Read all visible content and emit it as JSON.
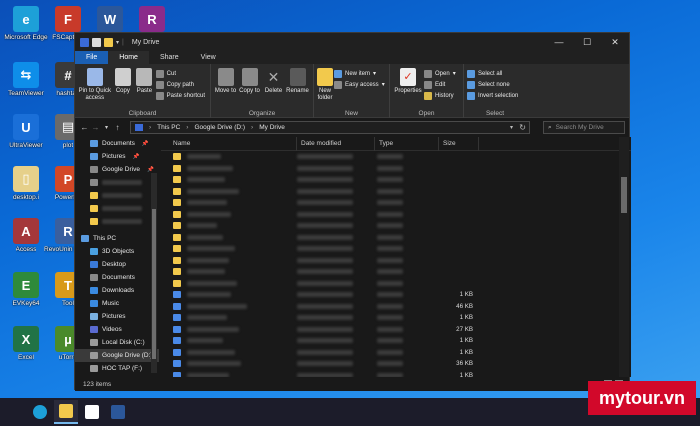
{
  "desktop": {
    "icons": [
      {
        "label": "Microsoft Edge",
        "glyph": "e",
        "color": "#1da0d8"
      },
      {
        "label": "FSCapture",
        "glyph": "F",
        "color": "#c83a2a"
      },
      {
        "label": "",
        "glyph": "W",
        "color": "#2b579a"
      },
      {
        "label": "",
        "glyph": "R",
        "color": "#8a2b8a"
      },
      {
        "label": "TeamViewer",
        "glyph": "⇆",
        "color": "#0e8ee9"
      },
      {
        "label": "hashtab",
        "glyph": "#",
        "color": "#3a3a3a"
      },
      {
        "label": "UltraViewer",
        "glyph": "U",
        "color": "#1a6fd8"
      },
      {
        "label": "plot",
        "glyph": "▤",
        "color": "#6a6a6a"
      },
      {
        "label": "desktop.i",
        "glyph": "▯",
        "color": "#e6d08a"
      },
      {
        "label": "PowerPo",
        "glyph": "P",
        "color": "#d24726"
      },
      {
        "label": "Access",
        "glyph": "A",
        "color": "#a4373a"
      },
      {
        "label": "RevoUnin Portabl",
        "glyph": "R",
        "color": "#3a5f9e"
      },
      {
        "label": "EVKey64",
        "glyph": "E",
        "color": "#2e8a3a"
      },
      {
        "label": "Tool",
        "glyph": "T",
        "color": "#d89a1a"
      },
      {
        "label": "Excel",
        "glyph": "X",
        "color": "#217346"
      },
      {
        "label": "uTorre",
        "glyph": "µ",
        "color": "#4a8a2a"
      }
    ]
  },
  "window": {
    "title": "My Drive",
    "controls": {
      "minimize": "—",
      "maximize": "☐",
      "close": "✕"
    },
    "tabs": [
      "File",
      "Home",
      "Share",
      "View"
    ],
    "ribbon": {
      "clipboard": {
        "name": "Clipboard",
        "pin": "Pin to Quick access",
        "copy": "Copy",
        "paste": "Paste",
        "cut": "Cut",
        "copy_path": "Copy path",
        "paste_shortcut": "Paste shortcut"
      },
      "organize": {
        "name": "Organize",
        "move_to": "Move to",
        "copy_to": "Copy to",
        "delete": "Delete",
        "rename": "Rename"
      },
      "new": {
        "name": "New",
        "new_folder": "New folder",
        "new_item": "New item",
        "easy_access": "Easy access"
      },
      "open": {
        "name": "Open",
        "properties": "Properties",
        "open": "Open",
        "edit": "Edit",
        "history": "History"
      },
      "select": {
        "name": "Select",
        "select_all": "Select all",
        "select_none": "Select none",
        "invert": "Invert selection"
      }
    },
    "address": {
      "crumbs": [
        "This PC",
        "Google Drive (D:)",
        "My Drive"
      ]
    },
    "search_placeholder": "Search My Drive",
    "navpane": {
      "quick": [
        {
          "label": "Documents",
          "pin": true,
          "color": "#5a9be0"
        },
        {
          "label": "Pictures",
          "pin": true,
          "color": "#5a9be0"
        },
        {
          "label": "Google Drive",
          "pin": true,
          "color": "#888888"
        }
      ],
      "this_pc": "This PC",
      "pc_items": [
        {
          "label": "3D Objects",
          "color": "#4aa0e0"
        },
        {
          "label": "Desktop",
          "color": "#3a7ad8"
        },
        {
          "label": "Documents",
          "color": "#8a8a8a"
        },
        {
          "label": "Downloads",
          "color": "#3a8ae0"
        },
        {
          "label": "Music",
          "color": "#3a8ae0"
        },
        {
          "label": "Pictures",
          "color": "#7ab0e0"
        },
        {
          "label": "Videos",
          "color": "#5a6ad0"
        },
        {
          "label": "Local Disk (C:)",
          "color": "#9a9a9a"
        },
        {
          "label": "Google Drive (D:)",
          "color": "#9a9a9a"
        },
        {
          "label": "HOC TAP (F:)",
          "color": "#9a9a9a"
        }
      ]
    },
    "columns": {
      "name": "Name",
      "date": "Date modified",
      "type": "Type",
      "size": "Size"
    },
    "files": [
      {
        "kind": "folder",
        "size": ""
      },
      {
        "kind": "folder",
        "size": ""
      },
      {
        "kind": "folder",
        "size": ""
      },
      {
        "kind": "folder",
        "size": ""
      },
      {
        "kind": "folder",
        "size": ""
      },
      {
        "kind": "folder",
        "size": ""
      },
      {
        "kind": "folder",
        "size": ""
      },
      {
        "kind": "folder",
        "size": ""
      },
      {
        "kind": "folder",
        "size": ""
      },
      {
        "kind": "folder",
        "size": ""
      },
      {
        "kind": "folder",
        "size": ""
      },
      {
        "kind": "folder",
        "size": ""
      },
      {
        "kind": "doc",
        "size": "1 KB"
      },
      {
        "kind": "doc",
        "size": "46 KB"
      },
      {
        "kind": "doc",
        "size": "1 KB"
      },
      {
        "kind": "doc",
        "size": "27 KB"
      },
      {
        "kind": "doc",
        "size": "1 KB"
      },
      {
        "kind": "doc",
        "size": "1 KB"
      },
      {
        "kind": "doc",
        "size": "36 KB"
      },
      {
        "kind": "doc",
        "size": "1 KB"
      }
    ],
    "status": "123 items"
  },
  "watermark": "mytour.vn"
}
